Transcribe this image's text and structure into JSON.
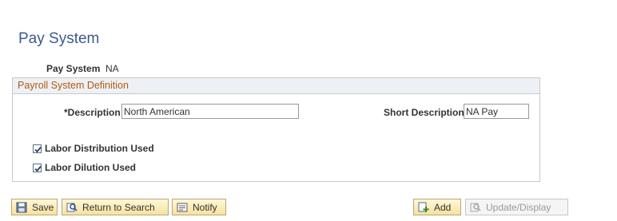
{
  "page": {
    "title": "Pay System"
  },
  "pay_system": {
    "label": "Pay System",
    "value": "NA"
  },
  "group": {
    "header": "Payroll System Definition",
    "description_label": "*Description",
    "description_value": "North American",
    "short_description_label": "Short Description",
    "short_description_value": "NA Pay",
    "labor_distribution_label": "Labor Distribution Used",
    "labor_distribution_checked": true,
    "labor_dilution_label": "Labor Dilution Used",
    "labor_dilution_checked": true
  },
  "toolbar": {
    "save_label": "Save",
    "return_label": "Return to Search",
    "notify_label": "Notify",
    "add_label": "Add",
    "update_label": "Update/Display"
  },
  "colors": {
    "title": "#3c5a8c",
    "group_header_text": "#b05a10",
    "group_header_bg": "#edf1f5",
    "button_bg": "#f6e29e"
  }
}
